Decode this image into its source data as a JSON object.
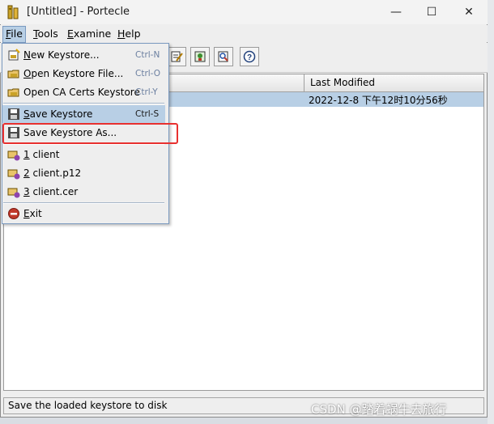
{
  "window": {
    "title": "[Untitled] - Portecle",
    "controls": {
      "minimize": "—",
      "maximize": "☐",
      "close": "✕"
    }
  },
  "menubar": {
    "file": {
      "mnemonic": "F",
      "rest": "ile"
    },
    "tools": {
      "mnemonic": "T",
      "rest": "ools"
    },
    "examine": {
      "mnemonic": "E",
      "rest": "xamine"
    },
    "help": {
      "mnemonic": "H",
      "rest": "elp"
    }
  },
  "file_menu": {
    "items": [
      {
        "mnemonic": "N",
        "rest": "ew Keystore...",
        "accel": "Ctrl-N",
        "icon": "new-keystore-icon"
      },
      {
        "mnemonic": "O",
        "rest": "pen Keystore File...",
        "accel": "Ctrl-O",
        "icon": "open-file-icon"
      },
      {
        "mnemonic": "",
        "rest": "Open CA Certs Keystore",
        "accel": "Ctrl-Y",
        "icon": "open-cacerts-icon"
      },
      {
        "mnemonic": "S",
        "rest": "ave Keystore",
        "accel": "Ctrl-S",
        "icon": "save-icon",
        "highlighted": true
      },
      {
        "mnemonic": "",
        "rest": "Save Keystore As...",
        "accel": "",
        "icon": "save-as-icon"
      },
      {
        "mnemonic": "1",
        "rest": " client",
        "accel": "",
        "icon": "recent-file-icon"
      },
      {
        "mnemonic": "2",
        "rest": " client.p12",
        "accel": "",
        "icon": "recent-file-icon"
      },
      {
        "mnemonic": "3",
        "rest": " client.cer",
        "accel": "",
        "icon": "recent-file-icon"
      },
      {
        "mnemonic": "E",
        "rest": "xit",
        "accel": "",
        "icon": "exit-icon"
      }
    ]
  },
  "table": {
    "columns": {
      "last_modified": "Last Modified"
    },
    "rows": [
      {
        "last_modified": "2022-12-8 下午12时10分56秒",
        "selected": true
      }
    ]
  },
  "statusbar": {
    "text": "Save the loaded keystore to disk"
  },
  "watermark": "CSDN @踏着蜗牛去旅行",
  "colors": {
    "selection": "#b8cfe5",
    "callout": "#e8302f",
    "accelerator": "#6b7fa0"
  }
}
